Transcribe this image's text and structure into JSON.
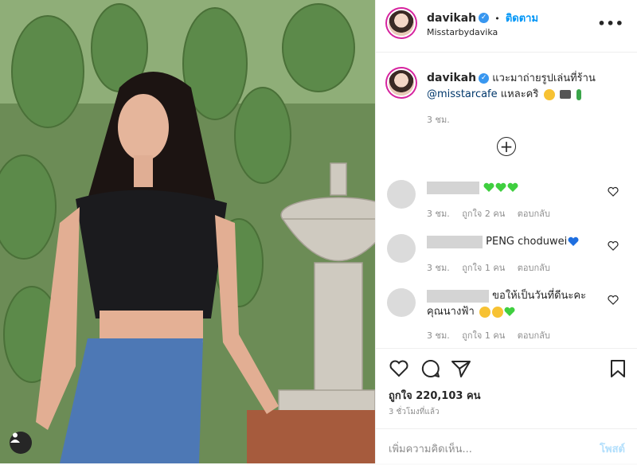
{
  "post": {
    "author": "davikah",
    "follow_label": "ติดตาม",
    "separator": "•",
    "location": "Misstarbydavika",
    "more_label": "•••",
    "caption_prefix": "แวะมาถ่ายรูปเล่นที่ร้าน",
    "caption_mention": "@misstarcafe",
    "caption_suffix": "แหละคริ",
    "caption_time": "3 ชม.",
    "load_more_label": "+"
  },
  "comments": [
    {
      "text": "",
      "time": "3 ชม.",
      "likes": "ถูกใจ 2 คน",
      "reply": "ตอบกลับ",
      "emojis": [
        "green-heart",
        "green-heart",
        "green-heart"
      ]
    },
    {
      "text": "PENG choduwei",
      "time": "3 ชม.",
      "likes": "ถูกใจ 1 คน",
      "reply": "ตอบกลับ",
      "emojis": [
        "blue-heart"
      ]
    },
    {
      "text": "ขอให้เป็นวันที่ดีนะคะ คุณนางฟ้า",
      "time": "3 ชม.",
      "likes": "ถูกใจ 1 คน",
      "reply": "ตอบกลับ",
      "emojis": [
        "smiling-face",
        "smiling-face",
        "green-heart"
      ]
    }
  ],
  "actions": {
    "likes_count": "ถูกใจ 220,103 คน",
    "posted_ago": "3 ชั่วโมงที่แล้ว",
    "add_comment_placeholder": "เพิ่มความคิดเห็น...",
    "post_label": "โพสต์"
  },
  "colors": {
    "accent": "#0095f6",
    "verified": "#3897f0",
    "green_heart": "#3fcf3f",
    "blue_heart": "#1f6fe0"
  },
  "icons": [
    "heart-icon",
    "comment-icon",
    "share-icon",
    "bookmark-icon",
    "user-tag-icon",
    "verified-badge-icon",
    "add-circle-icon"
  ]
}
